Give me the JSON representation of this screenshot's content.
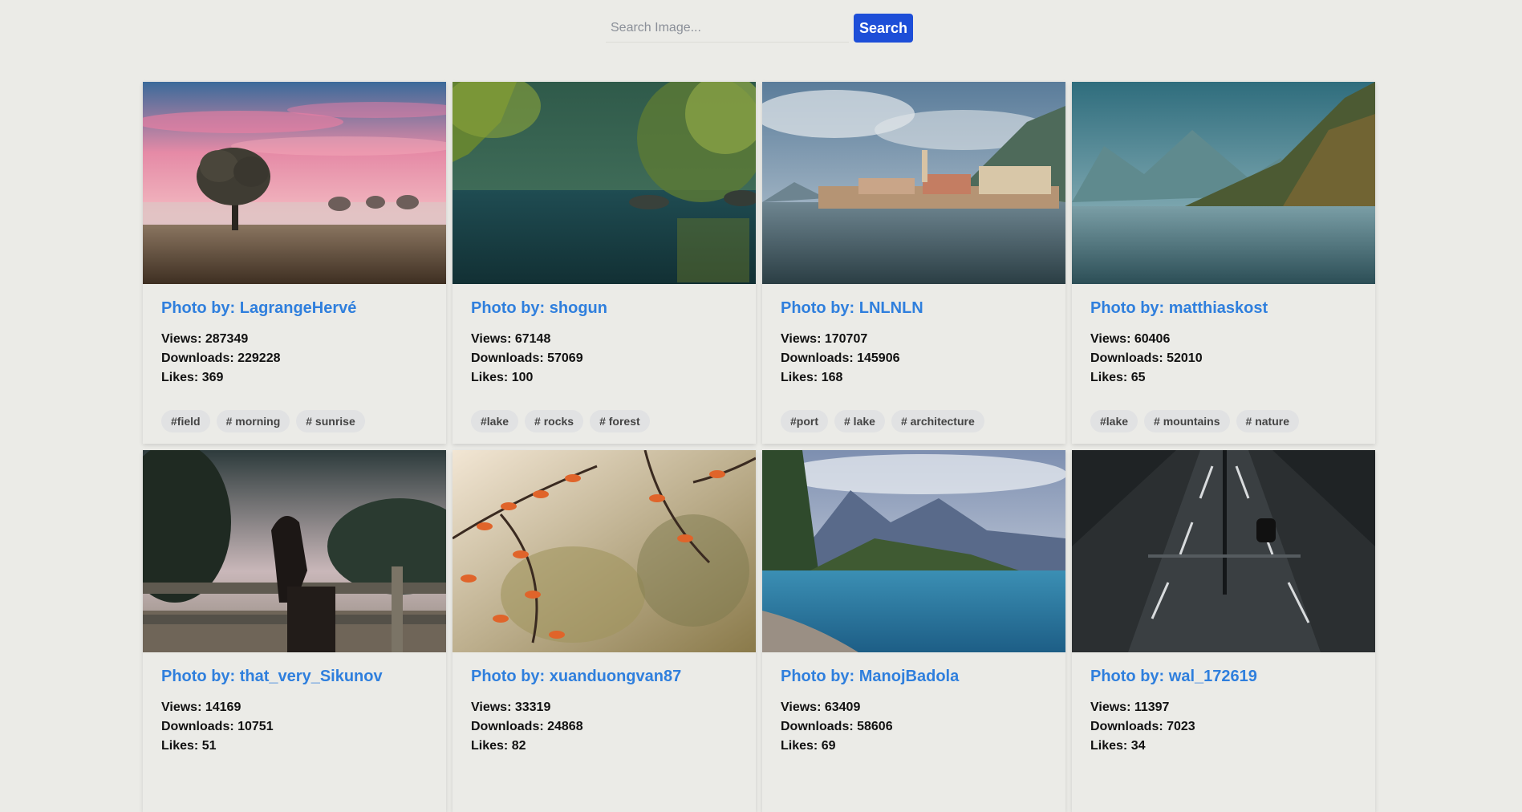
{
  "search": {
    "placeholder": "Search Image...",
    "value": "",
    "button_label": "Search",
    "button_color": "#1d4ed8"
  },
  "accent_color": "#2f7fdd",
  "cards": [
    {
      "author": "Photo by: LagrangeHervé",
      "views": "Views: 287349",
      "downloads": "Downloads: 229228",
      "likes": "Likes: 369",
      "tags": [
        "#field",
        "# morning",
        "# sunrise"
      ]
    },
    {
      "author": "Photo by: shogun",
      "views": "Views: 67148",
      "downloads": "Downloads: 57069",
      "likes": "Likes: 100",
      "tags": [
        "#lake",
        "# rocks",
        "# forest"
      ]
    },
    {
      "author": "Photo by: LNLNLN",
      "views": "Views: 170707",
      "downloads": "Downloads: 145906",
      "likes": "Likes: 168",
      "tags": [
        "#port",
        "# lake",
        "# architecture"
      ]
    },
    {
      "author": "Photo by: matthiaskost",
      "views": "Views: 60406",
      "downloads": "Downloads: 52010",
      "likes": "Likes: 65",
      "tags": [
        "#lake",
        "# mountains",
        "# nature"
      ]
    },
    {
      "author": "Photo by: that_very_Sikunov",
      "views": "Views: 14169",
      "downloads": "Downloads: 10751",
      "likes": "Likes: 51",
      "tags": []
    },
    {
      "author": "Photo by: xuanduongvan87",
      "views": "Views: 33319",
      "downloads": "Downloads: 24868",
      "likes": "Likes: 82",
      "tags": []
    },
    {
      "author": "Photo by: ManojBadola",
      "views": "Views: 63409",
      "downloads": "Downloads: 58606",
      "likes": "Likes: 69",
      "tags": []
    },
    {
      "author": "Photo by: wal_172619",
      "views": "Views: 11397",
      "downloads": "Downloads: 7023",
      "likes": "Likes: 34",
      "tags": []
    }
  ]
}
